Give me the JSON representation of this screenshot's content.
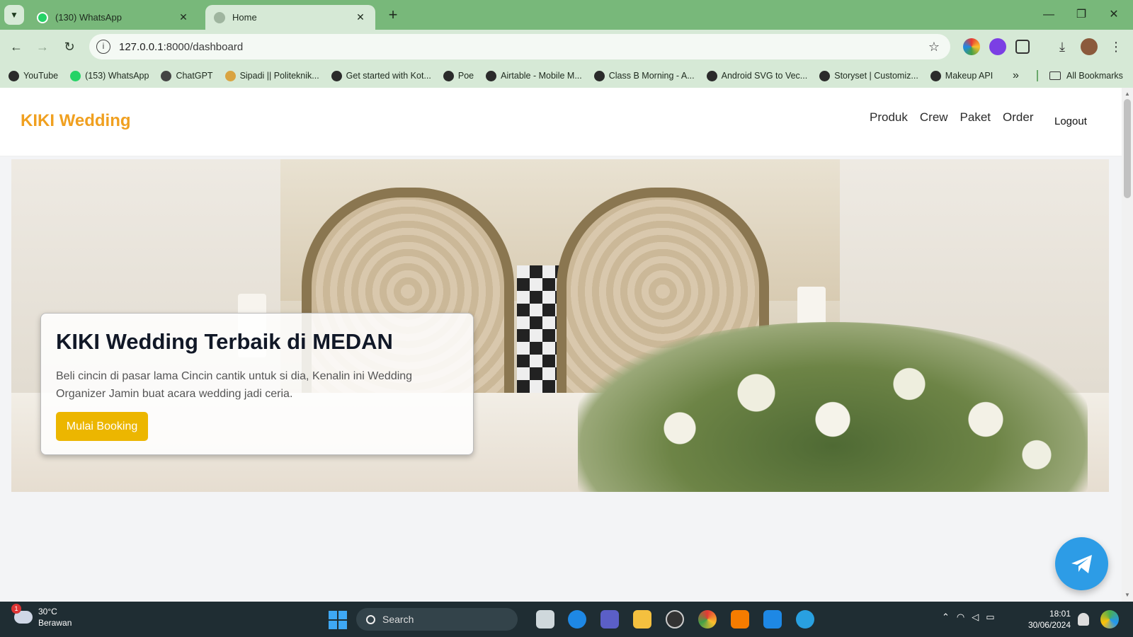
{
  "browser": {
    "tabs": [
      {
        "title": "(130) WhatsApp",
        "favicon": "whatsapp-icon",
        "active": false
      },
      {
        "title": "Home",
        "favicon": "globe-icon",
        "active": true
      }
    ],
    "url_host": "127.0.0.1",
    "url_path": ":8000/dashboard",
    "bookmarks": [
      {
        "label": "YouTube",
        "icon": "site-icon"
      },
      {
        "label": "(153) WhatsApp",
        "icon": "whatsapp-icon"
      },
      {
        "label": "ChatGPT",
        "icon": "chatgpt-icon"
      },
      {
        "label": "Sipadi || Politeknik...",
        "icon": "polytechnic-icon"
      },
      {
        "label": "Get started with Kot...",
        "icon": "site-icon"
      },
      {
        "label": "Poe",
        "icon": "site-icon"
      },
      {
        "label": "Airtable - Mobile M...",
        "icon": "site-icon"
      },
      {
        "label": "Class B Morning - A...",
        "icon": "site-icon"
      },
      {
        "label": "Android SVG to Vec...",
        "icon": "site-icon"
      },
      {
        "label": "Storyset | Customiz...",
        "icon": "site-icon"
      },
      {
        "label": "Makeup API",
        "icon": "site-icon"
      }
    ],
    "all_bookmarks": "All Bookmarks"
  },
  "site": {
    "brand": "KIKI Wedding",
    "brand_color": "#f0a020",
    "nav": [
      "Produk",
      "Crew",
      "Paket",
      "Order"
    ],
    "logout": "Logout"
  },
  "hero": {
    "title": "KIKI Wedding Terbaik di MEDAN",
    "text": "Beli cincin di pasar lama Cincin cantik untuk si dia, Kenalin ini Wedding Organizer Jamin buat acara wedding jadi ceria.",
    "button": "Mulai Booking",
    "button_color": "#ecb600"
  },
  "taskbar": {
    "weather_badge": "1",
    "temperature": "30°C",
    "condition": "Berawan",
    "search": "Search",
    "time": "18:01",
    "date": "30/06/2024"
  }
}
